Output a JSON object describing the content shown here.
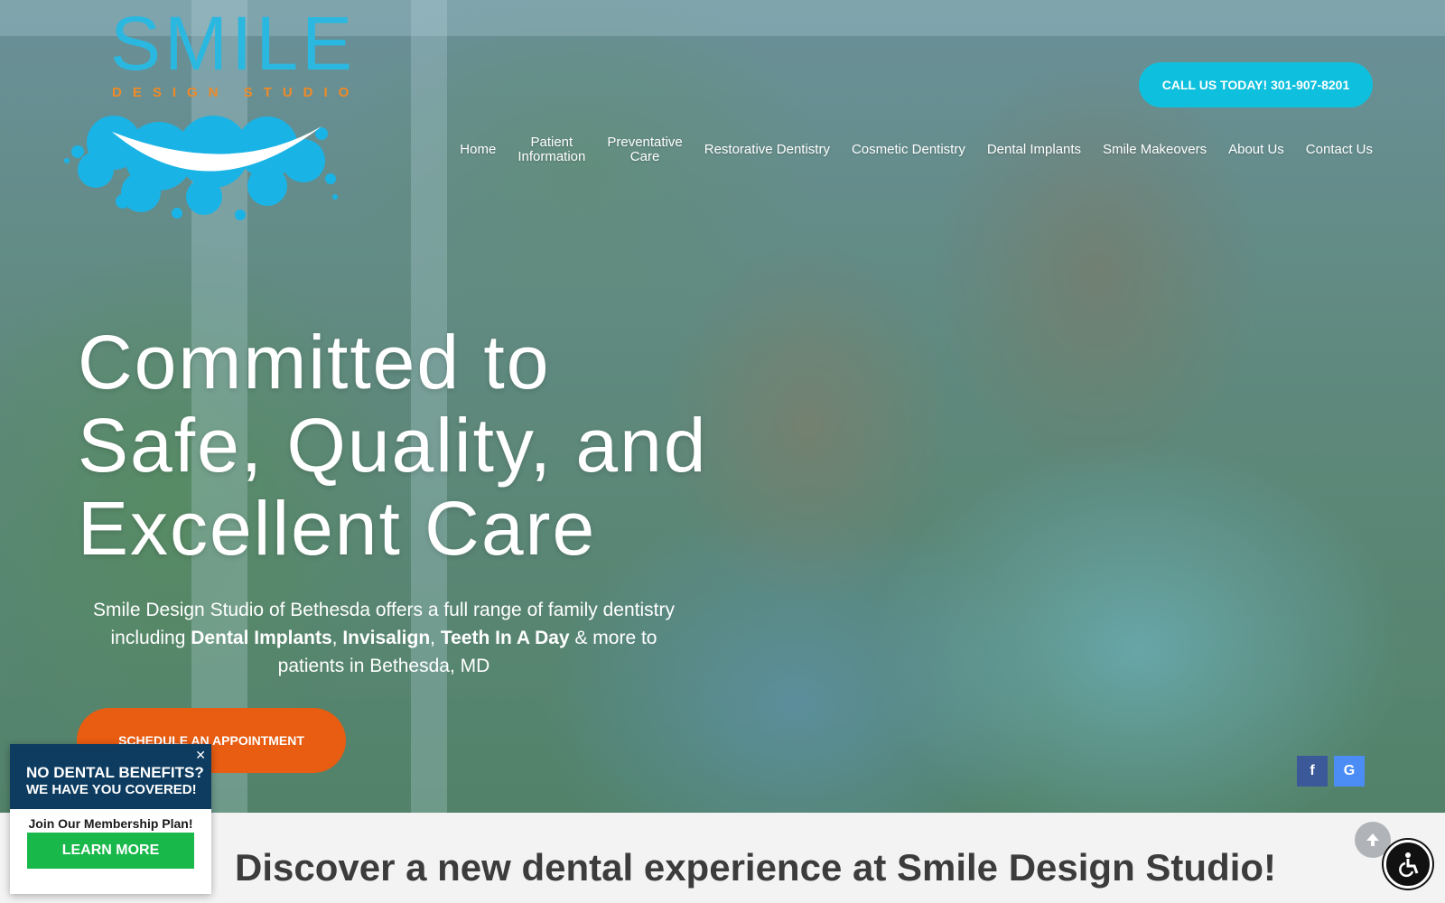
{
  "brand": {
    "name": "SMILE",
    "tagline": "DESIGN STUDIO",
    "colors": {
      "primary": "#0fc0de",
      "accent": "#e85d12",
      "logo_blue": "#2bb8e0",
      "logo_orange": "#f08a26"
    }
  },
  "header": {
    "call_label": "CALL US TODAY! 301-907-8201",
    "nav": [
      {
        "label": "Home"
      },
      {
        "label": "Patient\nInformation"
      },
      {
        "label": "Preventative\nCare"
      },
      {
        "label": "Restorative Dentistry"
      },
      {
        "label": "Cosmetic Dentistry"
      },
      {
        "label": "Dental Implants"
      },
      {
        "label": "Smile Makeovers"
      },
      {
        "label": "About Us"
      },
      {
        "label": "Contact Us"
      }
    ]
  },
  "hero": {
    "headline": "Committed to Safe, Quality, and Excellent Care",
    "intro_prefix": "Smile Design Studio of Bethesda offers a full range of family dentistry including",
    "intro_items": [
      "Dental Implants",
      "Invisalign",
      "Teeth In A Day"
    ],
    "intro_suffix": "& more to patients in Bethesda, MD",
    "schedule_label": "SCHEDULE AN APPOINTMENT"
  },
  "social": [
    {
      "icon": "facebook-icon",
      "glyph": "f"
    },
    {
      "icon": "google-icon",
      "glyph": "G"
    }
  ],
  "section": {
    "discover_title": "Discover a new dental experience at Smile Design Studio!"
  },
  "popup": {
    "title": "NO DENTAL BENEFITS?",
    "title2": "WE HAVE YOU COVERED!",
    "subtitle": "Join Our Membership Plan!",
    "button": "LEARN MORE",
    "close": "✕"
  },
  "widgets": {
    "scroll_top_icon": "arrow-up-icon",
    "accessibility_icon": "accessibility-icon"
  }
}
